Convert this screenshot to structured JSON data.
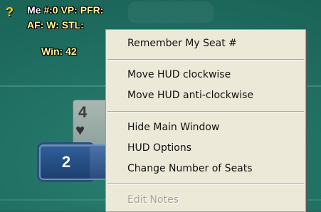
{
  "hud": {
    "help_icon": "question-arrow-icon",
    "line1": {
      "name": "Me",
      "hands": "#:0",
      "vpip": "VP:",
      "pfr": "PFR:"
    },
    "line2": {
      "af": "AF:",
      "wtsd": "W:",
      "steal": "STL:"
    },
    "line3": {
      "win": "Win: 42"
    }
  },
  "seat": {
    "number": "2"
  },
  "card": {
    "rank": "4",
    "suit": "♥"
  },
  "context_menu": {
    "items": [
      {
        "label": "Remember My Seat #",
        "enabled": true
      },
      {
        "label": "Move HUD clockwise",
        "enabled": true
      },
      {
        "label": "Move HUD anti-clockwise",
        "enabled": true
      },
      {
        "label": "Hide Main Window",
        "enabled": true
      },
      {
        "label": "HUD Options",
        "enabled": true
      },
      {
        "label": "Change Number of Seats",
        "enabled": true
      },
      {
        "label": "Edit Notes",
        "enabled": false
      }
    ]
  },
  "colors": {
    "felt": "#1f6e61",
    "hud_text": "#fff79a",
    "menu_bg": "#ece9d8",
    "seat_badge": "#2f5f99"
  }
}
